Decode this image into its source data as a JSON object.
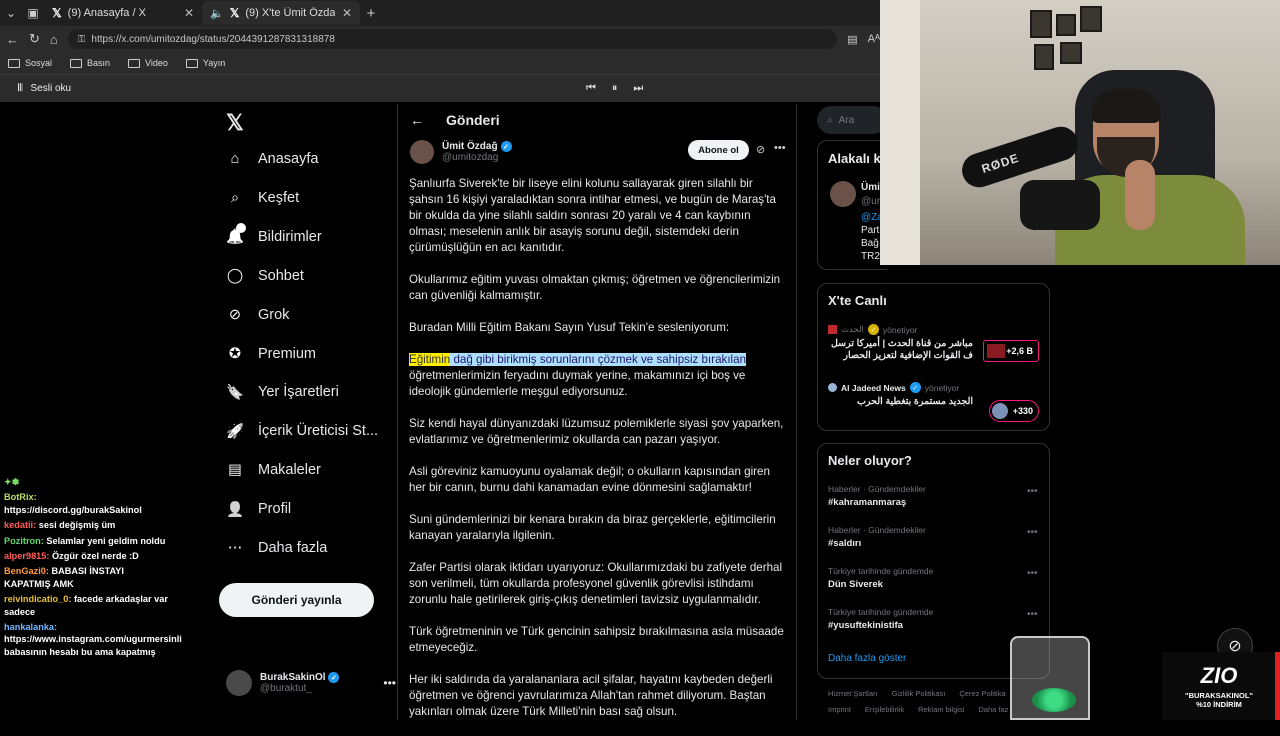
{
  "browser": {
    "tabs": [
      {
        "label": "(9) Anasayfa / X"
      },
      {
        "label": "(9) X'te Ümit Özdağ: \"Şanlıurfa"
      }
    ],
    "url": "https://x.com/umitozdag/status/2044391287831318878",
    "bookmarks": [
      "Sosyal",
      "Basın",
      "Video",
      "Yayın"
    ],
    "read_aloud": "Sesli oku"
  },
  "chat": [
    {
      "user": "",
      "text": "",
      "color": "#7ddf64"
    },
    {
      "user": "BotRix:",
      "text": "https://discord.gg/burakSakinol",
      "color": "#b9e066"
    },
    {
      "user": "kedatii:",
      "text": "sesi değişmiş üm",
      "color": "#ff5a5a"
    },
    {
      "user": "Pozitron:",
      "text": "Selamlar yeni geldim noldu",
      "color": "#63d66a"
    },
    {
      "user": "alper9815:",
      "text": "Özgür özel nerde :D",
      "color": "#ff5a5a"
    },
    {
      "user": "BenGazi0:",
      "text": "BABASI İNSTAYI KAPATMIŞ AMK",
      "color": "#ff9a3d"
    },
    {
      "user": "reivindicatio_0:",
      "text": "facede arkadaşlar var sadece",
      "color": "#e8c23a"
    },
    {
      "user": "hankalanka:",
      "text": "https://www.instagram.com/ugurmersinli babasının hesabı bu ama kapatmış",
      "color": "#6fb6ff"
    }
  ],
  "nav": {
    "items": [
      {
        "label": "Anasayfa",
        "icon": "home-icon"
      },
      {
        "label": "Keşfet",
        "icon": "search-icon"
      },
      {
        "label": "Bildirimler",
        "icon": "bell-icon"
      },
      {
        "label": "Sohbet",
        "icon": "chat-icon"
      },
      {
        "label": "Grok",
        "icon": "grok-icon"
      },
      {
        "label": "Premium",
        "icon": "premium-icon"
      },
      {
        "label": "Yer İşaretleri",
        "icon": "bookmark-icon"
      },
      {
        "label": "İçerik Üreticisi St...",
        "icon": "rocket-icon"
      },
      {
        "label": "Makaleler",
        "icon": "article-icon"
      },
      {
        "label": "Profil",
        "icon": "profile-icon"
      },
      {
        "label": "Daha fazla",
        "icon": "more-circle-icon"
      }
    ],
    "notification_badge": "9",
    "post_button": "Gönderi yayınla",
    "account": {
      "name": "BurakSakinOl",
      "handle": "@buraktut_"
    }
  },
  "post": {
    "header": "Gönderi",
    "author_name": "Ümit Özdağ",
    "author_handle": "@umitozdag",
    "subscribe": "Abone ol",
    "paragraphs": [
      "Şanlıurfa Siverek'te bir liseye elini kolunu sallayarak giren silahlı bir şahsın 16 kişiyi yaraladıktan sonra intihar etmesi, ve bugün de Maraş'ta bir okulda da yine silahlı saldırı sonrası 20 yaralı ve 4 can kaybının olması; meselenin anlık bir asayiş sorunu değil, sistemdeki derin çürümüşlüğün en acı kanıtıdır.",
      "Okullarımız eğitim yuvası olmaktan çıkmış; öğretmen ve öğrencilerimizin can güvenliği kalmamıştır.",
      "Buradan Milli Eğitim Bakanı Sayın Yusuf Tekin'e sesleniyorum:",
      "Siz kendi hayal dünyanızdaki lüzumsuz polemiklerle siyasi şov yaparken, evlatlarımız ve öğretmenlerimiz okullarda can pazarı yaşıyor.",
      "Asli göreviniz kamuoyunu oyalamak değil; o okulların kapısından giren her bir canın, burnu dahi kanamadan evine dönmesini sağlamaktır!",
      "Suni gündemlerinizi bir kenara bırakın da biraz gerçeklerle, eğitimcilerin kanayan yaralarıyla ilgilenin.",
      "Zafer Partisi olarak iktidarı uyarıyoruz: Okullarımızdaki bu zafiyete derhal son verilmeli, tüm okullarda profesyonel güvenlik görevlisi istihdamı zorunlu hale getirilerek giriş-çıkış denetimleri tavizsiz uygulanmalıdır.",
      "Türk öğretmeninin ve Türk gencinin sahipsiz bırakılmasına asla müsaade etmeyeceğiz.",
      "Her iki saldırıda da yaralananlara acil şifalar, hayatını kaybeden değerli öğretmen ve öğrenci yavrularımıza Allah'tan rahmet diliyorum. Baştan yakınları olmak üzere Türk Milleti'nin bası sağ olsun."
    ],
    "highlight_word": "Eğitimin",
    "highlight_rest": " dağ gibi birikmiş sorunlarını çözmek ve sahipsiz bırakılan",
    "highlight_after": " öğretmenlerimizin feryadını duymak yerine, makamınızı içi boş ve ideolojik gündemlerle meşgul ediyorsunuz."
  },
  "right": {
    "search_placeholder": "Ara",
    "related_title": "Alakalı k",
    "related_name": "Ümi",
    "related_handle": "@ur",
    "related_mention": "@Za",
    "related_lines": [
      "Part",
      "Bağ",
      "TR2"
    ],
    "live_title": "X'te Canlı",
    "live": [
      {
        "source": "الحدث",
        "role": "yönetiyor",
        "title": "مباشر من قناة الحدث | أميركا ترسل ف القوات الإضافية لتعزيز الحصار",
        "count": "+2,6 B"
      },
      {
        "source": "Al Jadeed News",
        "role": "yönetiyor",
        "title": "الجديد مستمرة بتغطية الحرب",
        "count": "+330"
      }
    ],
    "trends_title": "Neler oluyor?",
    "trends": [
      {
        "category": "Haberler · Gündemdekiler",
        "tag": "#kahramanmaraş"
      },
      {
        "category": "Haberler · Gündemdekiler",
        "tag": "#saldırı"
      },
      {
        "category": "Türkiye tarihinde gündemde",
        "tag": "Dün Siverek"
      },
      {
        "category": "Türkiye tarihinde gündemde",
        "tag": "#yusuftekinistifa"
      }
    ],
    "show_more": "Daha fazla göster",
    "footer_row1": [
      "Hizmet Şartları",
      "Gizlilik Politikası",
      "Çerez Politika"
    ],
    "footer_row2": [
      "Imprint",
      "Erişilebilirlik",
      "Reklam bilgisi",
      "Daha faz"
    ]
  },
  "overlay": {
    "mic_brand": "RØDE",
    "promo_logo": "ZIO",
    "promo_code": "\"BURAKSAKINOL\"",
    "promo_discount": "%10 İNDİRİM"
  }
}
